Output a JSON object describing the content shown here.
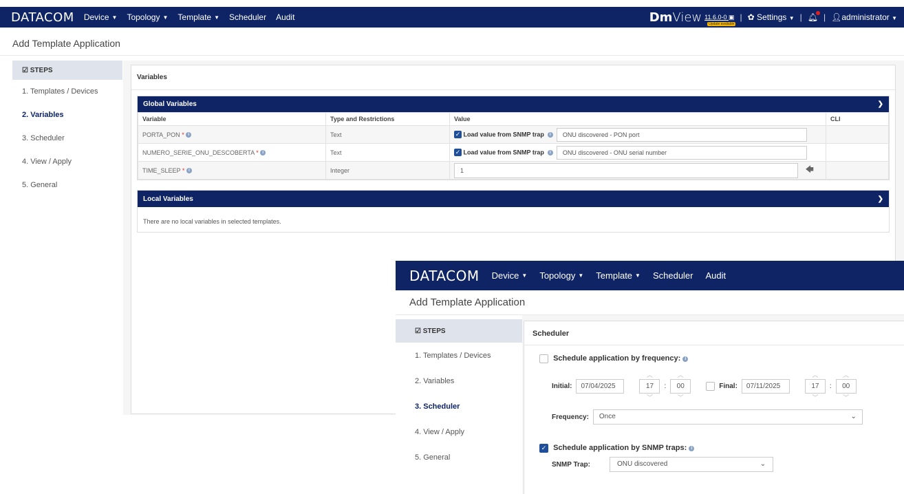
{
  "nav": {
    "logo": "DATACOM",
    "menu": [
      "Device",
      "Topology",
      "Template",
      "Scheduler",
      "Audit"
    ],
    "dm_logo_bold": "Dm",
    "dm_logo_light": "View",
    "version": "11.6.0-0",
    "update_badge": "Update available",
    "settings": "Settings",
    "user": "administrator"
  },
  "page_title": "Add Template Application",
  "steps": {
    "header": "STEPS",
    "items": [
      "1. Templates / Devices",
      "2. Variables",
      "3. Scheduler",
      "4. View / Apply",
      "5. General"
    ]
  },
  "variables": {
    "title": "Variables",
    "global_title": "Global Variables",
    "columns": [
      "Variable",
      "Type and Restrictions",
      "Value",
      "CLI"
    ],
    "rows": [
      {
        "name": "PORTA_PON",
        "type": "Text",
        "snmp_label": "Load value from SNMP trap",
        "value": "ONU discovered - PON port"
      },
      {
        "name": "NUMERO_SERIE_ONU_DESCOBERTA",
        "type": "Text",
        "snmp_label": "Load value from SNMP trap",
        "value": "ONU discovered - ONU serial number"
      },
      {
        "name": "TIME_SLEEP",
        "type": "Integer",
        "value": "1"
      }
    ],
    "local_title": "Local Variables",
    "local_empty": "There are no local variables in selected templates."
  },
  "scheduler": {
    "title": "Scheduler",
    "by_frequency": "Schedule application by frequency:",
    "initial_label": "Initial:",
    "initial_date": "07/04/2025",
    "initial_hour": "17",
    "initial_min": "00",
    "final_label": "Final:",
    "final_date": "07/11/2025",
    "final_hour": "17",
    "final_min": "00",
    "frequency_label": "Frequency:",
    "frequency_value": "Once",
    "by_snmp": "Schedule application by SNMP traps:",
    "snmp_trap_label": "SNMP Trap:",
    "snmp_trap_value": "ONU discovered"
  },
  "colors": {
    "navy": "#0f2464",
    "accent": "#1f4e9a"
  }
}
